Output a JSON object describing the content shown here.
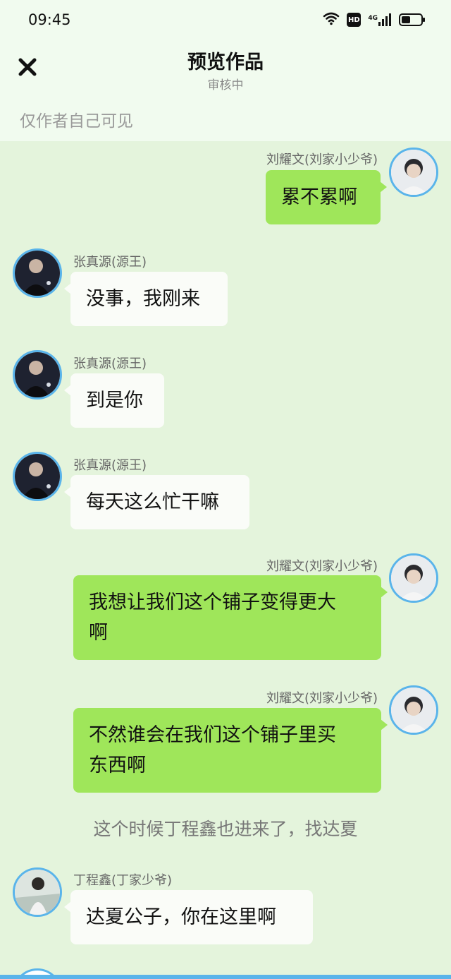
{
  "status_bar": {
    "time": "09:45",
    "hd_badge": "HD",
    "network": "4G",
    "battery_level": 0.45
  },
  "header": {
    "title": "预览作品",
    "subtitle": "审核中",
    "visibility_note": "仅作者自己可见",
    "close_icon": "close-icon"
  },
  "colors": {
    "background": "#e4f4dc",
    "header_bg": "#f1fbef",
    "bubble_self": "#9fe65a",
    "bubble_other": "#fafcf8",
    "avatar_border": "#5ab4ea"
  },
  "messages": [
    {
      "speaker": "刘耀文(刘家小少爷)",
      "side": "right",
      "text_lines": [
        "累不累啊"
      ]
    },
    {
      "speaker": "张真源(源王)",
      "side": "left",
      "text_lines": [
        "没事，我刚来"
      ]
    },
    {
      "speaker": "张真源(源王)",
      "side": "left",
      "text_lines": [
        "到是你"
      ]
    },
    {
      "speaker": "张真源(源王)",
      "side": "left",
      "text_lines": [
        "每天这么忙干嘛"
      ]
    },
    {
      "speaker": "刘耀文(刘家小少爷)",
      "side": "right",
      "text_lines": [
        "我想让我们这个铺子变得更大",
        "啊"
      ]
    },
    {
      "speaker": "刘耀文(刘家小少爷)",
      "side": "right",
      "text_lines": [
        "不然谁会在我们这个铺子里买",
        "东西啊"
      ]
    },
    {
      "narration": "这个时候丁程鑫也进来了，找达夏"
    },
    {
      "speaker": "丁程鑫(丁家少爷)",
      "side": "left",
      "text_lines": [
        "达夏公子，你在这里啊"
      ]
    }
  ]
}
